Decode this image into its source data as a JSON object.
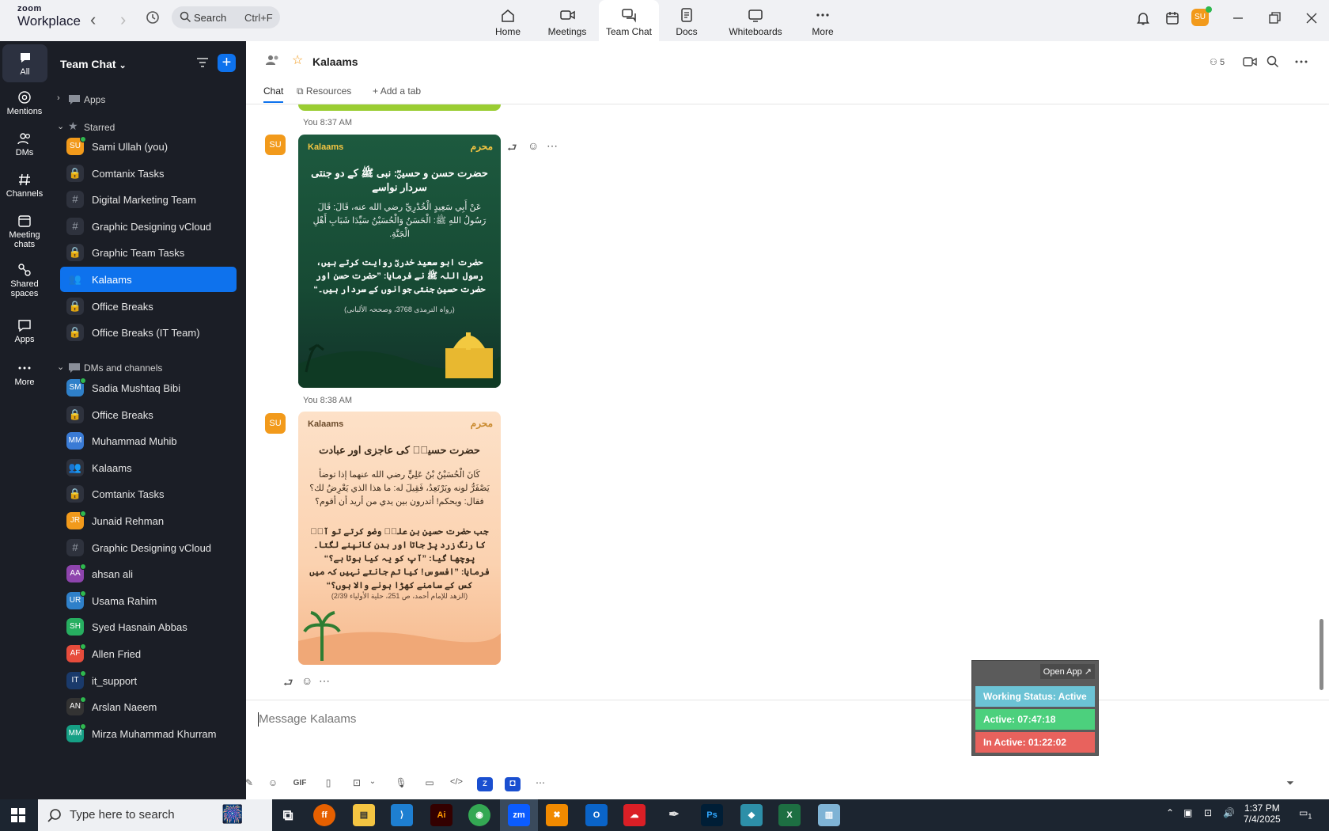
{
  "app": {
    "logo_line1": "zoom",
    "logo_line2": "Workplace"
  },
  "search": {
    "label": "Search",
    "shortcut": "Ctrl+F"
  },
  "top_nav": [
    {
      "label": "Home",
      "icon": "home-icon"
    },
    {
      "label": "Meetings",
      "icon": "video-icon"
    },
    {
      "label": "Team Chat",
      "icon": "chat-icon",
      "active": true
    },
    {
      "label": "Docs",
      "icon": "doc-icon"
    },
    {
      "label": "Whiteboards",
      "icon": "whiteboard-icon"
    },
    {
      "label": "More",
      "icon": "more-icon"
    }
  ],
  "user": {
    "initials": "SU"
  },
  "rail": [
    {
      "label": "All",
      "active": true
    },
    {
      "label": "Mentions"
    },
    {
      "label": "DMs"
    },
    {
      "label": "Channels"
    },
    {
      "label": "Meeting chats"
    },
    {
      "label": "Shared spaces"
    },
    {
      "label": "Apps"
    },
    {
      "label": "More"
    }
  ],
  "sidebar": {
    "title": "Team Chat",
    "sections": {
      "apps": "Apps",
      "starred": "Starred",
      "dms": "DMs and channels"
    },
    "starred": [
      {
        "label": "Sami Ullah (you)",
        "type": "avatar",
        "initials": "SU",
        "color": "#f29a1b",
        "online": true
      },
      {
        "label": "Comtanix Tasks",
        "type": "lock"
      },
      {
        "label": "Digital Marketing Team",
        "type": "hash"
      },
      {
        "label": "Graphic Designing vCloud",
        "type": "hash"
      },
      {
        "label": "Graphic Team Tasks",
        "type": "lock"
      },
      {
        "label": "Kalaams",
        "type": "group",
        "selected": true
      },
      {
        "label": "Office Breaks",
        "type": "lock"
      },
      {
        "label": "Office Breaks (IT Team)",
        "type": "lock"
      }
    ],
    "dms": [
      {
        "label": "Sadia Mushtaq Bibi",
        "type": "avatar",
        "initials": "SM",
        "color": "#2f80c9",
        "online": true
      },
      {
        "label": "Office Breaks",
        "type": "lock"
      },
      {
        "label": "Muhammad Muhib",
        "type": "avatar",
        "initials": "MM",
        "color": "#3a7bd5",
        "online": false
      },
      {
        "label": "Kalaams",
        "type": "group"
      },
      {
        "label": "Comtanix Tasks",
        "type": "lock"
      },
      {
        "label": "Junaid Rehman",
        "type": "avatar",
        "initials": "JR",
        "color": "#f29a1b",
        "online": true
      },
      {
        "label": "Graphic Designing vCloud",
        "type": "hash"
      },
      {
        "label": "ahsan ali",
        "type": "avatar",
        "initials": "AA",
        "color": "#8e44ad",
        "online": true
      },
      {
        "label": "Usama Rahim",
        "type": "avatar",
        "initials": "UR",
        "color": "#2f80c9",
        "online": true
      },
      {
        "label": "Syed Hasnain Abbas",
        "type": "avatar",
        "initials": "SH",
        "color": "#27ae60",
        "online": false
      },
      {
        "label": "Allen Fried",
        "type": "avatar",
        "initials": "AF",
        "color": "#e74c3c",
        "online": true
      },
      {
        "label": "it_support",
        "type": "avatar",
        "initials": "IT",
        "color": "#1a3a6b",
        "online": true
      },
      {
        "label": "Arslan Naeem",
        "type": "avatar",
        "initials": "AN",
        "color": "#333333",
        "online": true
      },
      {
        "label": "Mirza Muhammad Khurram",
        "type": "avatar",
        "initials": "MM",
        "color": "#16a085",
        "online": true
      }
    ]
  },
  "channel": {
    "title": "Kalaams",
    "member_count": "5",
    "tabs": {
      "chat": "Chat",
      "resources": "Resources",
      "add": "Add a tab"
    },
    "composer_placeholder": "Message Kalaams"
  },
  "messages": [
    {
      "meta": "You 8:37 AM",
      "avatar": "SU",
      "card": {
        "brand": "Kalaams",
        "badge": "محرم",
        "heading": "حضرت حسن و حسینؓ: نبی ﷺ کے دو جنتی سردار نواسے",
        "arabic": "عَنْ أَبِي سَعِيدٍ الْخُدْرِيِّ رضي الله عنه، قَالَ: قَالَ رَسُولُ اللهِ ﷺ: الْحَسَنُ وَالْحُسَيْنُ سَيِّدَا شَبَابِ أَهْلِ الْجَنَّةِ.",
        "urdu": "حضرت ابو سعید خدریؓ روایت کرتے ہیں، رسول اللہ ﷺ نے فرمایا: ”حضرت حسن اور حضرت حسین جنتی جوانوں کے سردار ہیں۔“",
        "ref": "(رواہ الترمذی 3768، وصححہ الألبانی)"
      }
    },
    {
      "meta": "You 8:38 AM",
      "avatar": "SU",
      "card": {
        "brand": "Kalaams",
        "badge": "محرم",
        "heading": "حضرت حسینؓ کی عاجزی اور عبادت",
        "arabic": "كَانَ الْحُسَيْنُ بْنُ عَلِيٍّ رضي الله عنهما إذا توضأ يَصْفَرُّ لونه ويَرْتَعِدُ، فَقِيلَ له: ما هذا الذي يَعْرِضُ لك؟ فقال: ويحكم! أتدرون بين يدي من أريد أن أقوم؟",
        "urdu": "جب حضرت حسین بن علیؓ وضو کرتے تو آپؓ کا رنگ زرد پڑ جاتا اور بدن کانپنے لگتا۔ پوچھا گیا: ”آپ کو یہ کیا ہوتا ہے؟“ فرمایا: ”افسوس! کیا تم جانتے نہیں کہ میں کس کے سامنے کھڑا ہونے والا ہوں؟“",
        "ref": "(الزهد للإمام أحمد، ص 251، حلية الأولياء 2/39)"
      }
    }
  ],
  "widget": {
    "open_app": "Open App ↗",
    "status": "Working Status: Active",
    "active": "Active: 07:47:18",
    "inactive": "In Active: 01:22:02",
    "colors": {
      "status": "#6cc3d5",
      "active": "#4cd07d",
      "inactive": "#e8625d"
    }
  },
  "taskbar": {
    "search_placeholder": "Type here to search",
    "time": "1:37 PM",
    "date": "7/4/2025",
    "notifications": "1"
  },
  "accent": "#0e72ed"
}
